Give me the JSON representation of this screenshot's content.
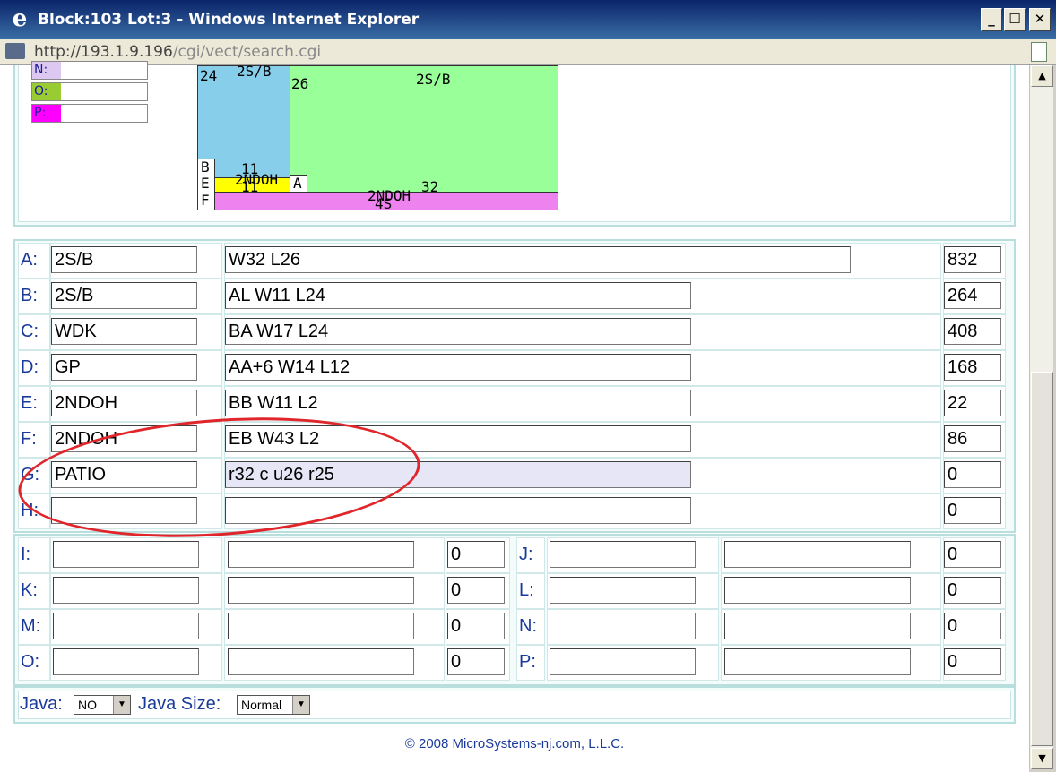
{
  "window": {
    "title": "Block:103 Lot:3 - Windows Internet Explorer",
    "minimize": "_",
    "maximize": "☐",
    "close": "✕"
  },
  "address": {
    "host": "http://193.1.9.196",
    "path": "/cgi/vect/search.cgi"
  },
  "legend": [
    {
      "label": "N:",
      "color": "#dcc8f0"
    },
    {
      "label": "O:",
      "color": "#99cc33"
    },
    {
      "label": "P:",
      "color": "#ff00ff"
    }
  ],
  "sketch": {
    "labels": {
      "n24": "24",
      "n26": "26",
      "s2sb_left": "2S/B",
      "s2sb_main": "2S/B",
      "b": "B",
      "e": "E",
      "f": "F",
      "a": "A",
      "n11a": "11",
      "n11b": "11",
      "ndoh1": "2NDOH",
      "ndoh2": "2NDOH",
      "n32": "32",
      "s4s": "4S"
    }
  },
  "rows": [
    {
      "label": "A:",
      "type": "2S/B",
      "desc": "W32 L26",
      "area": "832"
    },
    {
      "label": "B:",
      "type": "2S/B",
      "desc": "AL W11 L24",
      "area": "264"
    },
    {
      "label": "C:",
      "type": "WDK",
      "desc": "BA W17 L24",
      "area": "408"
    },
    {
      "label": "D:",
      "type": "GP",
      "desc": "AA+6 W14 L12",
      "area": "168"
    },
    {
      "label": "E:",
      "type": "2NDOH",
      "desc": "BB W11 L2",
      "area": "22"
    },
    {
      "label": "F:",
      "type": "2NDOH",
      "desc": "EB W43 L2",
      "area": "86"
    },
    {
      "label": "G:",
      "type": "PATIO",
      "desc": "r32 c u26 r25",
      "area": "0"
    },
    {
      "label": "H:",
      "type": "",
      "desc": "",
      "area": "0"
    }
  ],
  "grid": [
    {
      "l1": "I:",
      "v1": "0",
      "l2": "J:",
      "v2": "0"
    },
    {
      "l1": "K:",
      "v1": "0",
      "l2": "L:",
      "v2": "0"
    },
    {
      "l1": "M:",
      "v1": "0",
      "l2": "N:",
      "v2": "0"
    },
    {
      "l1": "O:",
      "v1": "0",
      "l2": "P:",
      "v2": "0"
    }
  ],
  "options": {
    "java_label": "Java:",
    "java_value": "NO",
    "size_label": "Java Size:",
    "size_value": "Normal"
  },
  "footer": "© 2008 MicroSystems-nj.com, L.L.C."
}
